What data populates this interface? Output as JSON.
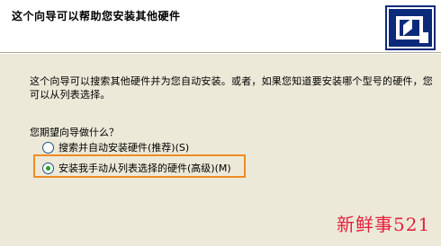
{
  "header": {
    "title": "这个向导可以帮助您安装其他硬件",
    "icon": "hardware-wizard-icon"
  },
  "body": {
    "intro": "这个向导可以搜索其他硬件并为您自动安装。或者，如果您知道要安装哪个型号的硬件，您可以从列表选择。",
    "question": "您期望向导做什么？",
    "options": [
      {
        "label": "搜索并自动安装硬件(推荐)(S)",
        "checked": false
      },
      {
        "label": "安装我手动从列表选择的硬件(高级)(M)",
        "checked": true
      }
    ]
  },
  "watermark": "新鲜事521",
  "colors": {
    "highlight": "#f08a24",
    "watermark": "#e5203e",
    "radio_dot": "#21a121"
  }
}
